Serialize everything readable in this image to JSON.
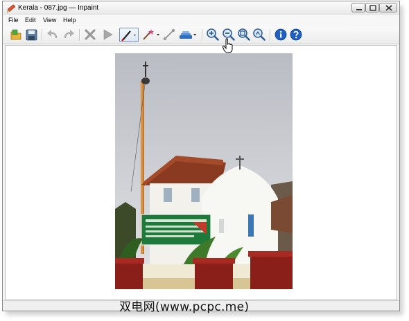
{
  "window": {
    "title": "Kerala - 087.jpg — Inpaint",
    "controls": [
      "minimize-icon",
      "maximize-icon",
      "close-icon"
    ]
  },
  "menu": {
    "items": [
      "File",
      "Edit",
      "View",
      "Help"
    ]
  },
  "toolbar": {
    "tools": [
      "open-icon",
      "save-icon",
      "undo-icon",
      "redo-icon",
      "delete-icon",
      "run-icon",
      "marker-icon",
      "magic-wand-icon",
      "line-icon",
      "stamp-icon",
      "zoom-in-icon",
      "zoom-out-icon",
      "zoom-fit-icon",
      "zoom-actual-icon",
      "info-icon",
      "help-icon"
    ]
  },
  "document": {
    "image_subject": "church-with-flag-pole",
    "sign_color": "#1e7a3a"
  },
  "colors": {
    "title_bar": "#eeeeee",
    "window_bg": "#f4f4f4",
    "canvas_bg": "#ffffff",
    "accent_blue": "#1f5fbf"
  },
  "watermark": {
    "text": "双电网(www.pcpc.me)"
  }
}
